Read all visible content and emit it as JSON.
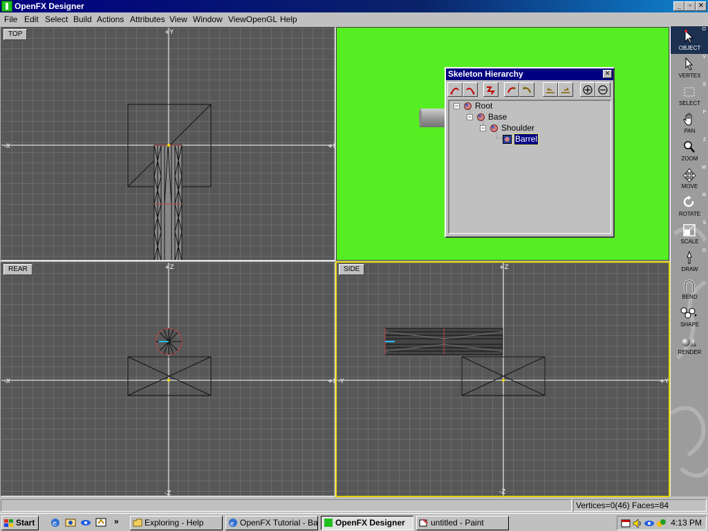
{
  "window": {
    "title": "OpenFX Designer"
  },
  "menu": [
    "File",
    "Edit",
    "Select",
    "Build",
    "Actions",
    "Attributes",
    "View",
    "Window",
    "ViewOpenGL",
    "Help"
  ],
  "viewports": {
    "top": {
      "label": "TOP",
      "axis_up": "+Y",
      "axis_left": "-X",
      "axis_right": "+X"
    },
    "rear": {
      "label": "REAR",
      "axis_up": "+Z",
      "axis_down": "-Z",
      "axis_left": "-X",
      "axis_right": "+X"
    },
    "side": {
      "label": "SIDE",
      "axis_up": "+Z",
      "axis_down": "-Z",
      "axis_left": "-Y",
      "axis_right": "+Y"
    }
  },
  "dialog": {
    "title": "Skeleton Hierarchy",
    "tree": [
      {
        "label": "Root",
        "depth": 0,
        "expander": "−"
      },
      {
        "label": "Base",
        "depth": 1,
        "expander": "−"
      },
      {
        "label": "Shoulder",
        "depth": 2,
        "expander": "−"
      },
      {
        "label": "Barrel",
        "depth": 3,
        "selected": true
      }
    ]
  },
  "tools": [
    {
      "label": "OBJECT",
      "key": "O",
      "icon": "arrow-icon",
      "active": true
    },
    {
      "label": "VERTEX",
      "key": "V",
      "icon": "arrow-small-icon"
    },
    {
      "label": "SELECT",
      "key": "S",
      "icon": "marquee-icon"
    },
    {
      "label": "PAN",
      "key": "P",
      "icon": "hand-icon"
    },
    {
      "label": "ZOOM",
      "key": "Z",
      "icon": "magnifier-icon"
    },
    {
      "label": "MOVE",
      "key": "M",
      "icon": "move-arrows-icon"
    },
    {
      "label": "ROTATE",
      "key": "R",
      "icon": "rotate-icon"
    },
    {
      "label": "SCALE",
      "key": "S",
      "icon": "scale-icon"
    },
    {
      "label": "DRAW",
      "key": "D",
      "icon": "pen-icon"
    },
    {
      "label": "BEND",
      "key": "",
      "icon": "bend-icon"
    },
    {
      "label": "SHAPE",
      "key": "",
      "icon": "shape-icon"
    },
    {
      "label": "RENDER",
      "key": "",
      "icon": "render-icon"
    }
  ],
  "status": {
    "message": "",
    "counts": "Vertices=0(46) Faces=84"
  },
  "taskbar": {
    "start": "Start",
    "tasks": [
      {
        "label": "Exploring - Help",
        "icon": "folder-icon"
      },
      {
        "label": "OpenFX Tutorial - Ba...",
        "icon": "browser-icon"
      },
      {
        "label": "OpenFX Designer",
        "icon": "openfx-icon",
        "pressed": true
      },
      {
        "label": "untitled - Paint",
        "icon": "paint-icon"
      }
    ],
    "clock": "4:13 PM"
  },
  "colors": {
    "titlebar": "#000080",
    "render_bg": "#55ee22",
    "viewport_bg": "#575757",
    "active_viewport_border": "#e0d000"
  }
}
